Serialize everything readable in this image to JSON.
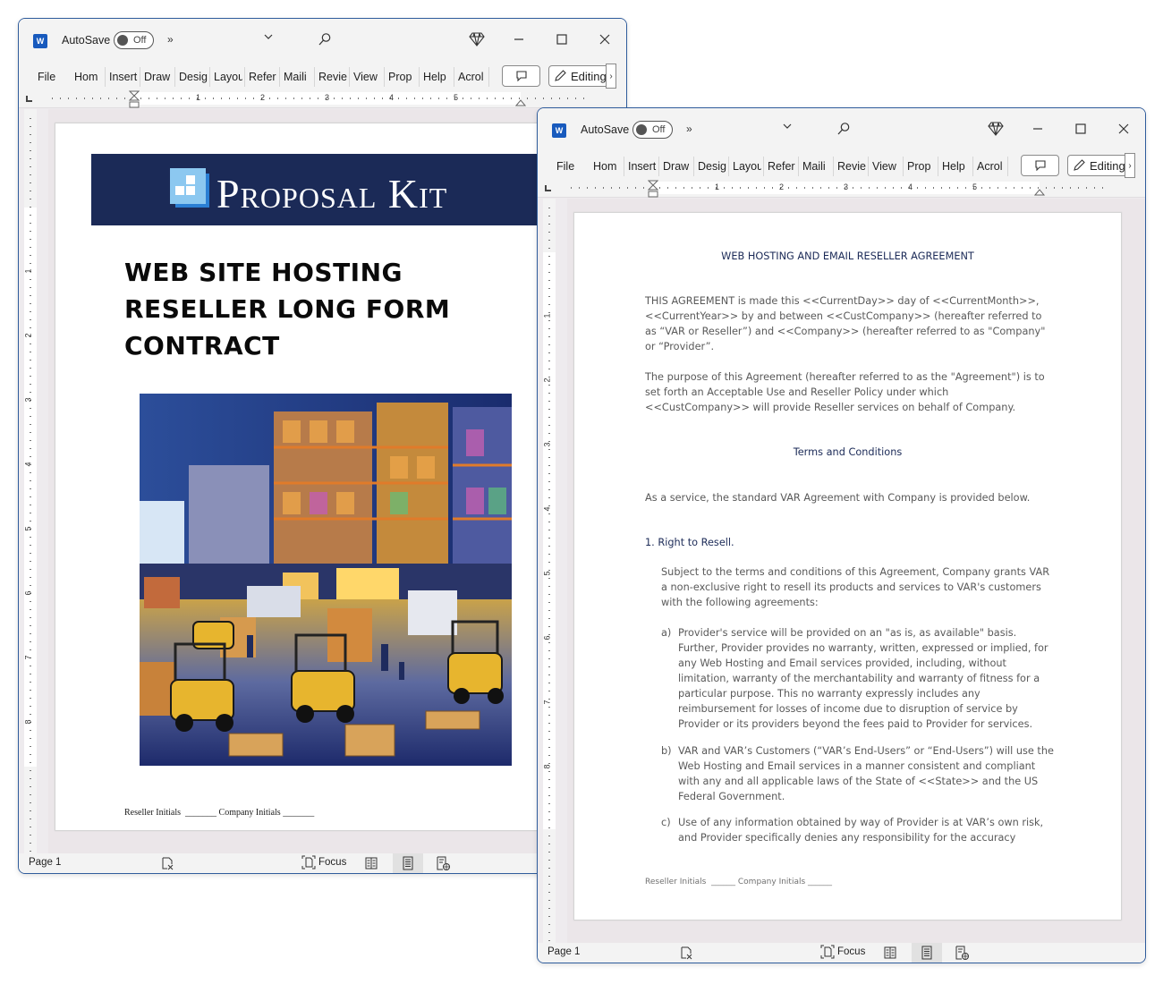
{
  "windows": [
    {
      "titlebar": {
        "app_icon": "word-icon",
        "autosave_label": "AutoSave",
        "autosave_state": "Off",
        "more_label": "»",
        "icons": [
          "chevron-down-icon",
          "search-icon",
          "diamond-icon",
          "minimize-icon",
          "maximize-icon",
          "close-icon"
        ]
      },
      "ribbon": {
        "tabs": [
          "File",
          "Home",
          "Insert",
          "Draw",
          "Design",
          "Layout",
          "References",
          "Mailings",
          "Review",
          "View",
          "Properties",
          "Help",
          "Acrobat"
        ],
        "tabs_visible": [
          "File",
          "Hom",
          "Insert",
          "Draw",
          "Desig",
          "Layou",
          "Refer",
          "Maili",
          "Revie",
          "View",
          "Prop",
          "Help",
          "Acrol"
        ],
        "comment_icon": "comment-icon",
        "editing_label": "Editing",
        "expand_label": "›"
      },
      "ruler": {
        "numbers": [
          "1",
          "2",
          "3",
          "4",
          "5"
        ],
        "vertical_numbers": [
          "1",
          "2",
          "3",
          "4",
          "5",
          "6",
          "7",
          "8"
        ]
      },
      "page": {
        "brand": "Proposal Kit",
        "title_lines": [
          "WEB SITE HOSTING",
          "RESELLER LONG FORM",
          "CONTRACT"
        ],
        "image_alt": "Illustrated warehouse with forklifts, shelving stacked with boxes, trucks at loading docks",
        "footer_initials": "Reseller Initials  _______ Company Initials _______"
      },
      "statusbar": {
        "page_label": "Page 1",
        "focus_label": "Focus"
      }
    },
    {
      "titlebar": {
        "app_icon": "word-icon",
        "autosave_label": "AutoSave",
        "autosave_state": "Off",
        "more_label": "»"
      },
      "ribbon": {
        "tabs_visible": [
          "File",
          "Hom",
          "Insert",
          "Draw",
          "Desig",
          "Layou",
          "Refer",
          "Maili",
          "Revie",
          "View",
          "Prop",
          "Help",
          "Acrol"
        ],
        "editing_label": "Editing",
        "expand_label": "›"
      },
      "ruler": {
        "numbers": [
          "1",
          "2",
          "3",
          "4",
          "5"
        ],
        "vertical_numbers": [
          "1",
          "2",
          "3",
          "4",
          "5",
          "6",
          "7",
          "8"
        ]
      },
      "page": {
        "heading": "WEB HOSTING AND EMAIL RESELLER AGREEMENT",
        "intro": "THIS AGREEMENT is made this <<CurrentDay>> day of <<CurrentMonth>>, <<CurrentYear>> by and between <<CustCompany>> (hereafter referred to as “VAR or Reseller”) and <<Company>> (hereafter referred to as \"Company\" or “Provider”.",
        "purpose": "The purpose of this Agreement (hereafter referred to as the \"Agreement\") is to set forth an Acceptable Use and Reseller Policy under which <<CustCompany>> will provide Reseller services on behalf of Company.",
        "terms_heading": "Terms and Conditions",
        "service_line": "As a service, the standard VAR Agreement with Company is provided below.",
        "section1_heading": "1. Right to Resell.",
        "section1_body": "Subject to the terms and conditions of this Agreement, Company grants VAR a non-exclusive right to resell its products and services to VAR's customers with the following agreements:",
        "items": [
          {
            "marker": "a)",
            "text": "Provider's service will be provided on an \"as is, as available\" basis. Further, Provider provides no warranty, written, expressed or implied, for any Web Hosting and Email services provided, including, without limitation, warranty of the merchantability and warranty of fitness for a particular purpose. This no warranty expressly includes any reimbursement for losses of income due to disruption of service by Provider or its providers beyond the fees paid to Provider for services."
          },
          {
            "marker": "b)",
            "text": "VAR and VAR’s Customers (“VAR’s End-Users” or “End-Users”) will use the Web Hosting and Email services in a manner consistent and compliant with any and all applicable laws of the State of <<State>> and the US Federal Government."
          },
          {
            "marker": "c)",
            "text": "Use of any information obtained by way of Provider is at VAR’s own risk, and Provider specifically denies any responsibility for the accuracy"
          }
        ],
        "footer_initials": "Reseller Initials  ______ Company Initials ______"
      },
      "statusbar": {
        "page_label": "Page 1",
        "focus_label": "Focus"
      }
    }
  ]
}
